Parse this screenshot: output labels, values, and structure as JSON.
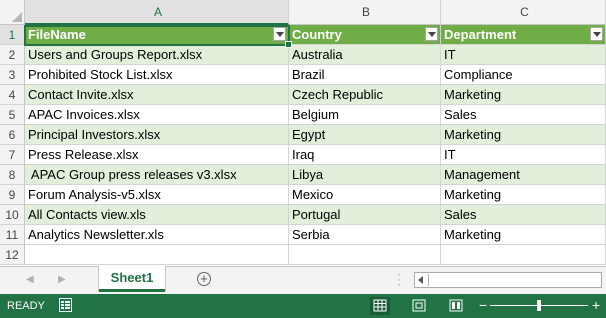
{
  "column_headers": [
    "A",
    "B",
    "C"
  ],
  "row_numbers": [
    "1",
    "2",
    "3",
    "4",
    "5",
    "6",
    "7",
    "8",
    "9",
    "10",
    "11",
    "12"
  ],
  "table": {
    "headers": [
      "FileName",
      "Country",
      "Department"
    ],
    "rows": [
      [
        "Users and Groups Report.xlsx",
        "Australia",
        "IT"
      ],
      [
        "Prohibited Stock List.xlsx",
        "Brazil",
        "Compliance"
      ],
      [
        "Contact Invite.xlsx",
        "Czech Republic",
        "Marketing"
      ],
      [
        "APAC Invoices.xlsx",
        "Belgium",
        "Sales"
      ],
      [
        "Principal Investors.xlsx",
        "Egypt",
        "Marketing"
      ],
      [
        "Press Release.xlsx",
        "Iraq",
        "IT"
      ],
      [
        " APAC Group press releases v3.xlsx",
        "Libya",
        "Management"
      ],
      [
        "Forum Analysis-v5.xlsx",
        "Mexico",
        "Marketing"
      ],
      [
        "All Contacts view.xls",
        "Portugal",
        "Sales"
      ],
      [
        "Analytics Newsletter.xls",
        "Serbia",
        "Marketing"
      ]
    ]
  },
  "sheet_tabs": [
    "Sheet1"
  ],
  "status": {
    "ready": "READY",
    "zoom_minus": "−",
    "zoom_plus": "+"
  },
  "colors": {
    "header_green": "#70ad47",
    "band_green": "#e2efda",
    "excel_green": "#217346"
  }
}
